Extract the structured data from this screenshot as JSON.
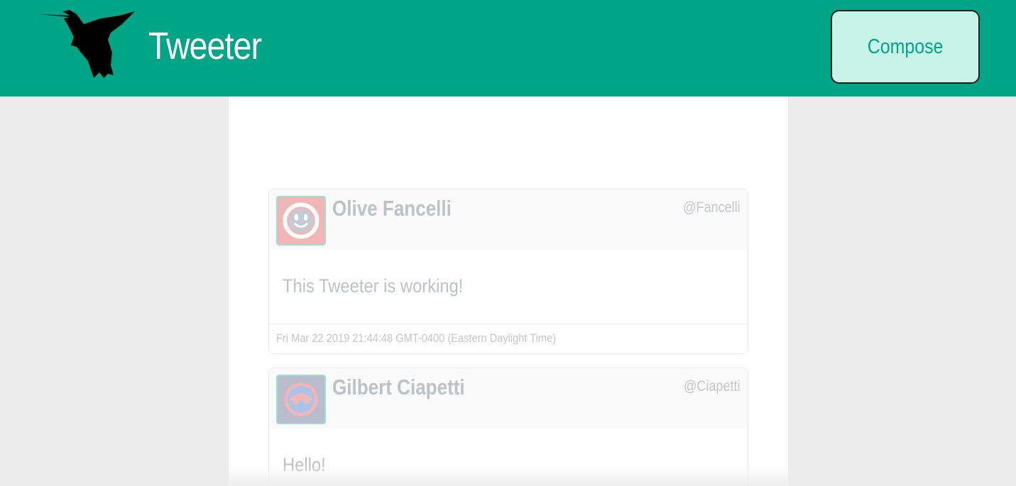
{
  "navbar": {
    "brand": "Tweeter",
    "logo_icon": "hummingbird-icon",
    "compose_label": "Compose",
    "color": "#00a587"
  },
  "tweets": [
    {
      "name": "Olive Fancelli",
      "handle": "@Fancelli",
      "text": "This Tweeter is working!",
      "timestamp": "Fri Mar 22 2019 21:44:48 GMT-0400 (Eastern Daylight Time)",
      "avatar_icon": "smiley-avatar-icon"
    },
    {
      "name": "Gilbert Ciapetti",
      "handle": "@Ciapetti",
      "text": "Hello!",
      "avatar_icon": "robot-avatar-icon"
    }
  ]
}
